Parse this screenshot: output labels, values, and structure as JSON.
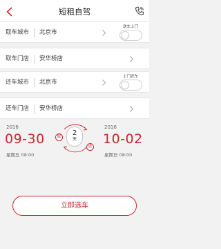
{
  "header": {
    "title": "短租自驾"
  },
  "pickup_city": {
    "label": "取车城市",
    "value": "北京市",
    "toggle_label": "送车上门",
    "toggle_on": false
  },
  "pickup_store": {
    "label": "取车门店",
    "value": "安华桥店"
  },
  "return_city": {
    "label": "还车城市",
    "value": "北京市",
    "toggle_label": "上门还车",
    "toggle_on": false
  },
  "return_store": {
    "label": "还车门店",
    "value": "安华桥店"
  },
  "pickup_date": {
    "year": "2016",
    "date": "09-30",
    "weekday_time": "星期五 08:00"
  },
  "return_date": {
    "year": "2016",
    "date": "10-02",
    "weekday_time": "星期日 08:00"
  },
  "duration": {
    "take_tag": "取",
    "return_tag": "还",
    "days": "2",
    "unit": "天"
  },
  "cta": {
    "label": "立即选车"
  },
  "colors": {
    "accent": "#c9282d",
    "background": "#f2f2f2"
  },
  "icons": {
    "back": "chevron-left-icon",
    "phone": "phone-icon",
    "row": "chevron-right-icon"
  }
}
